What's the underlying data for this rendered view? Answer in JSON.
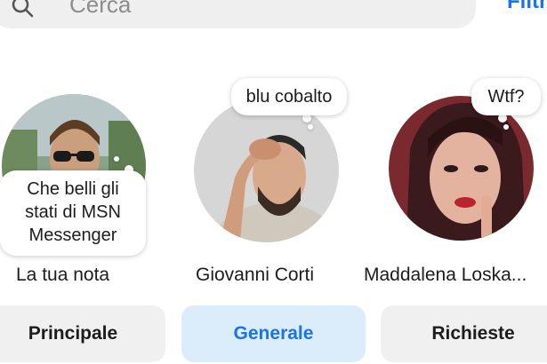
{
  "search": {
    "placeholder": "Cerca",
    "filter_label": "Filtri"
  },
  "notes": [
    {
      "name": "La tua nota",
      "note": "Che belli gli stati di MSN Messenger"
    },
    {
      "name": "Giovanni Corti",
      "note": "blu cobalto"
    },
    {
      "name": "Maddalena Loska...",
      "note": "Wtf?"
    }
  ],
  "tabs": [
    {
      "label": "Principale",
      "active": false
    },
    {
      "label": "Generale",
      "active": true
    },
    {
      "label": "Richieste",
      "active": false
    }
  ],
  "colors": {
    "accent": "#1a73e8",
    "active_tab_bg": "#dbecfb",
    "tab_bg": "#f0f0f0"
  }
}
